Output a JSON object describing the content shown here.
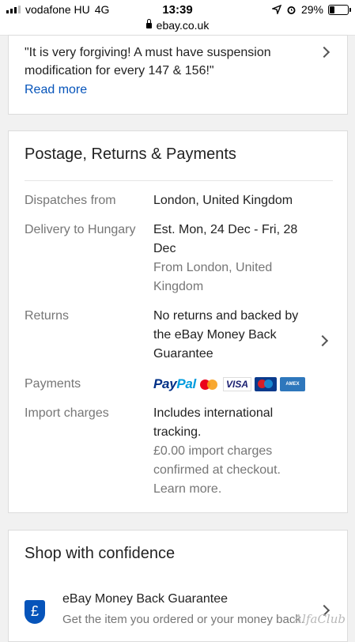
{
  "status_bar": {
    "carrier": "vodafone HU",
    "network": "4G",
    "time": "13:39",
    "url": "ebay.co.uk",
    "battery_text": "29%",
    "battery_level": 0.29
  },
  "review_card": {
    "quote": "\"It is very forgiving! A must have suspension modification for every 147 & 156!\"",
    "read_more": "Read more"
  },
  "postage": {
    "title": "Postage, Returns & Payments",
    "rows": [
      {
        "label": "Dispatches from",
        "value": "London, United Kingdom"
      },
      {
        "label": "Delivery to Hungary",
        "value": "Est. Mon, 24 Dec - Fri, 28 Dec",
        "sub": "From London, United Kingdom"
      },
      {
        "label": "Returns",
        "value": "No returns and backed by the eBay Money Back Guarantee"
      },
      {
        "label": "Payments",
        "value": ""
      },
      {
        "label": "Import charges",
        "value": "Includes international tracking.",
        "sub": "£0.00 import charges confirmed at checkout. Learn more."
      }
    ],
    "payment_logos": {
      "paypal_a": "Pay",
      "paypal_b": "Pal",
      "visa": "VISA",
      "amex": "AMERICAN EXPRESS"
    }
  },
  "confidence": {
    "title": "Shop with confidence",
    "guarantee_title": "eBay Money Back Guarantee",
    "guarantee_sub": "Get the item you ordered or your money back.",
    "shield_symbol": "£"
  },
  "watermark": "AlfaClub"
}
